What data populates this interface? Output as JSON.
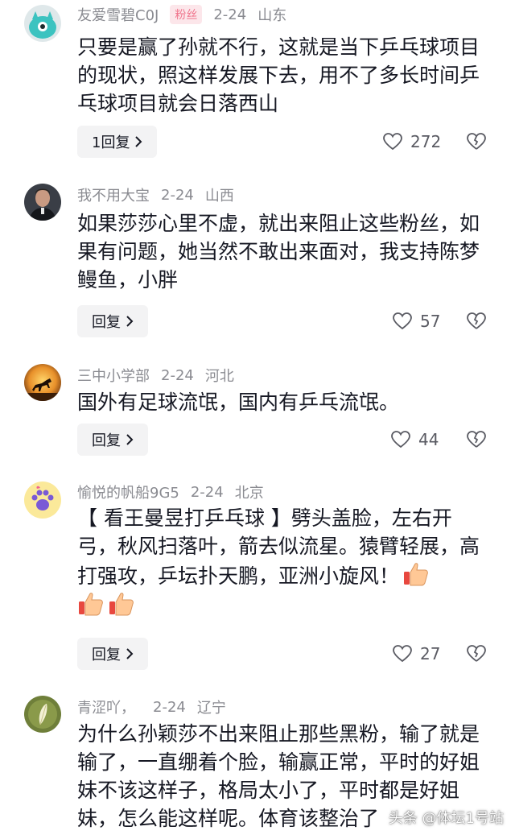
{
  "comments": [
    {
      "username": "友爱雪碧C0J",
      "badge": "粉丝",
      "date": "2-24",
      "location": "山东",
      "text": "只要是赢了孙就不行，这就是当下乒乓球项目的现状，照这样发展下去，用不了多长时间乒乓球项目就会日落西山",
      "reply_label": "1回复",
      "likes": "272",
      "avatar_icon": "teal-cartoon-avatar"
    },
    {
      "username": "我不用大宝",
      "date": "2-24",
      "location": "山西",
      "text": "如果莎莎心里不虚，就出来阻止这些粉丝，如果有问题，她当然不敢出来面对，我支持陈梦 鳗鱼，小胖",
      "reply_label": "回复",
      "likes": "57",
      "avatar_icon": "man-portrait-avatar"
    },
    {
      "username": "三中小学部",
      "date": "2-24",
      "location": "河北",
      "text": "国外有足球流氓，国内有乒乓流氓。",
      "reply_label": "回复",
      "likes": "44",
      "avatar_icon": "horse-sunset-avatar"
    },
    {
      "username": "愉悦的帆船9G5",
      "date": "2-24",
      "location": "北京",
      "text": "【 看王曼昱打乒乓球 】劈头盖脸，左右开弓，秋风扫落叶，箭去似流星。猿臂轻展，高打强攻，乒坛扑天鹏，亚洲小旋风！",
      "reply_label": "回复",
      "likes": "27",
      "avatar_icon": "paw-avatar"
    },
    {
      "username": "青涩吖，",
      "date": "2-24",
      "location": "辽宁",
      "text": "为什么孙颖莎不出来阻止那些黑粉，输了就是输了，一直绷着个脸，输赢正常，平时的好姐妹不该这样子，格局太小了，平时都是好姐妹，怎么能这样呢。体育该整治了",
      "avatar_icon": "green-leaf-avatar"
    }
  ],
  "watermark": "头条 @体坛1号站",
  "colors": {
    "badge_bg": "#fce6ea",
    "badge_fg": "#f0748c",
    "meta": "#8a8b91",
    "button_bg": "#f3f3f4"
  }
}
